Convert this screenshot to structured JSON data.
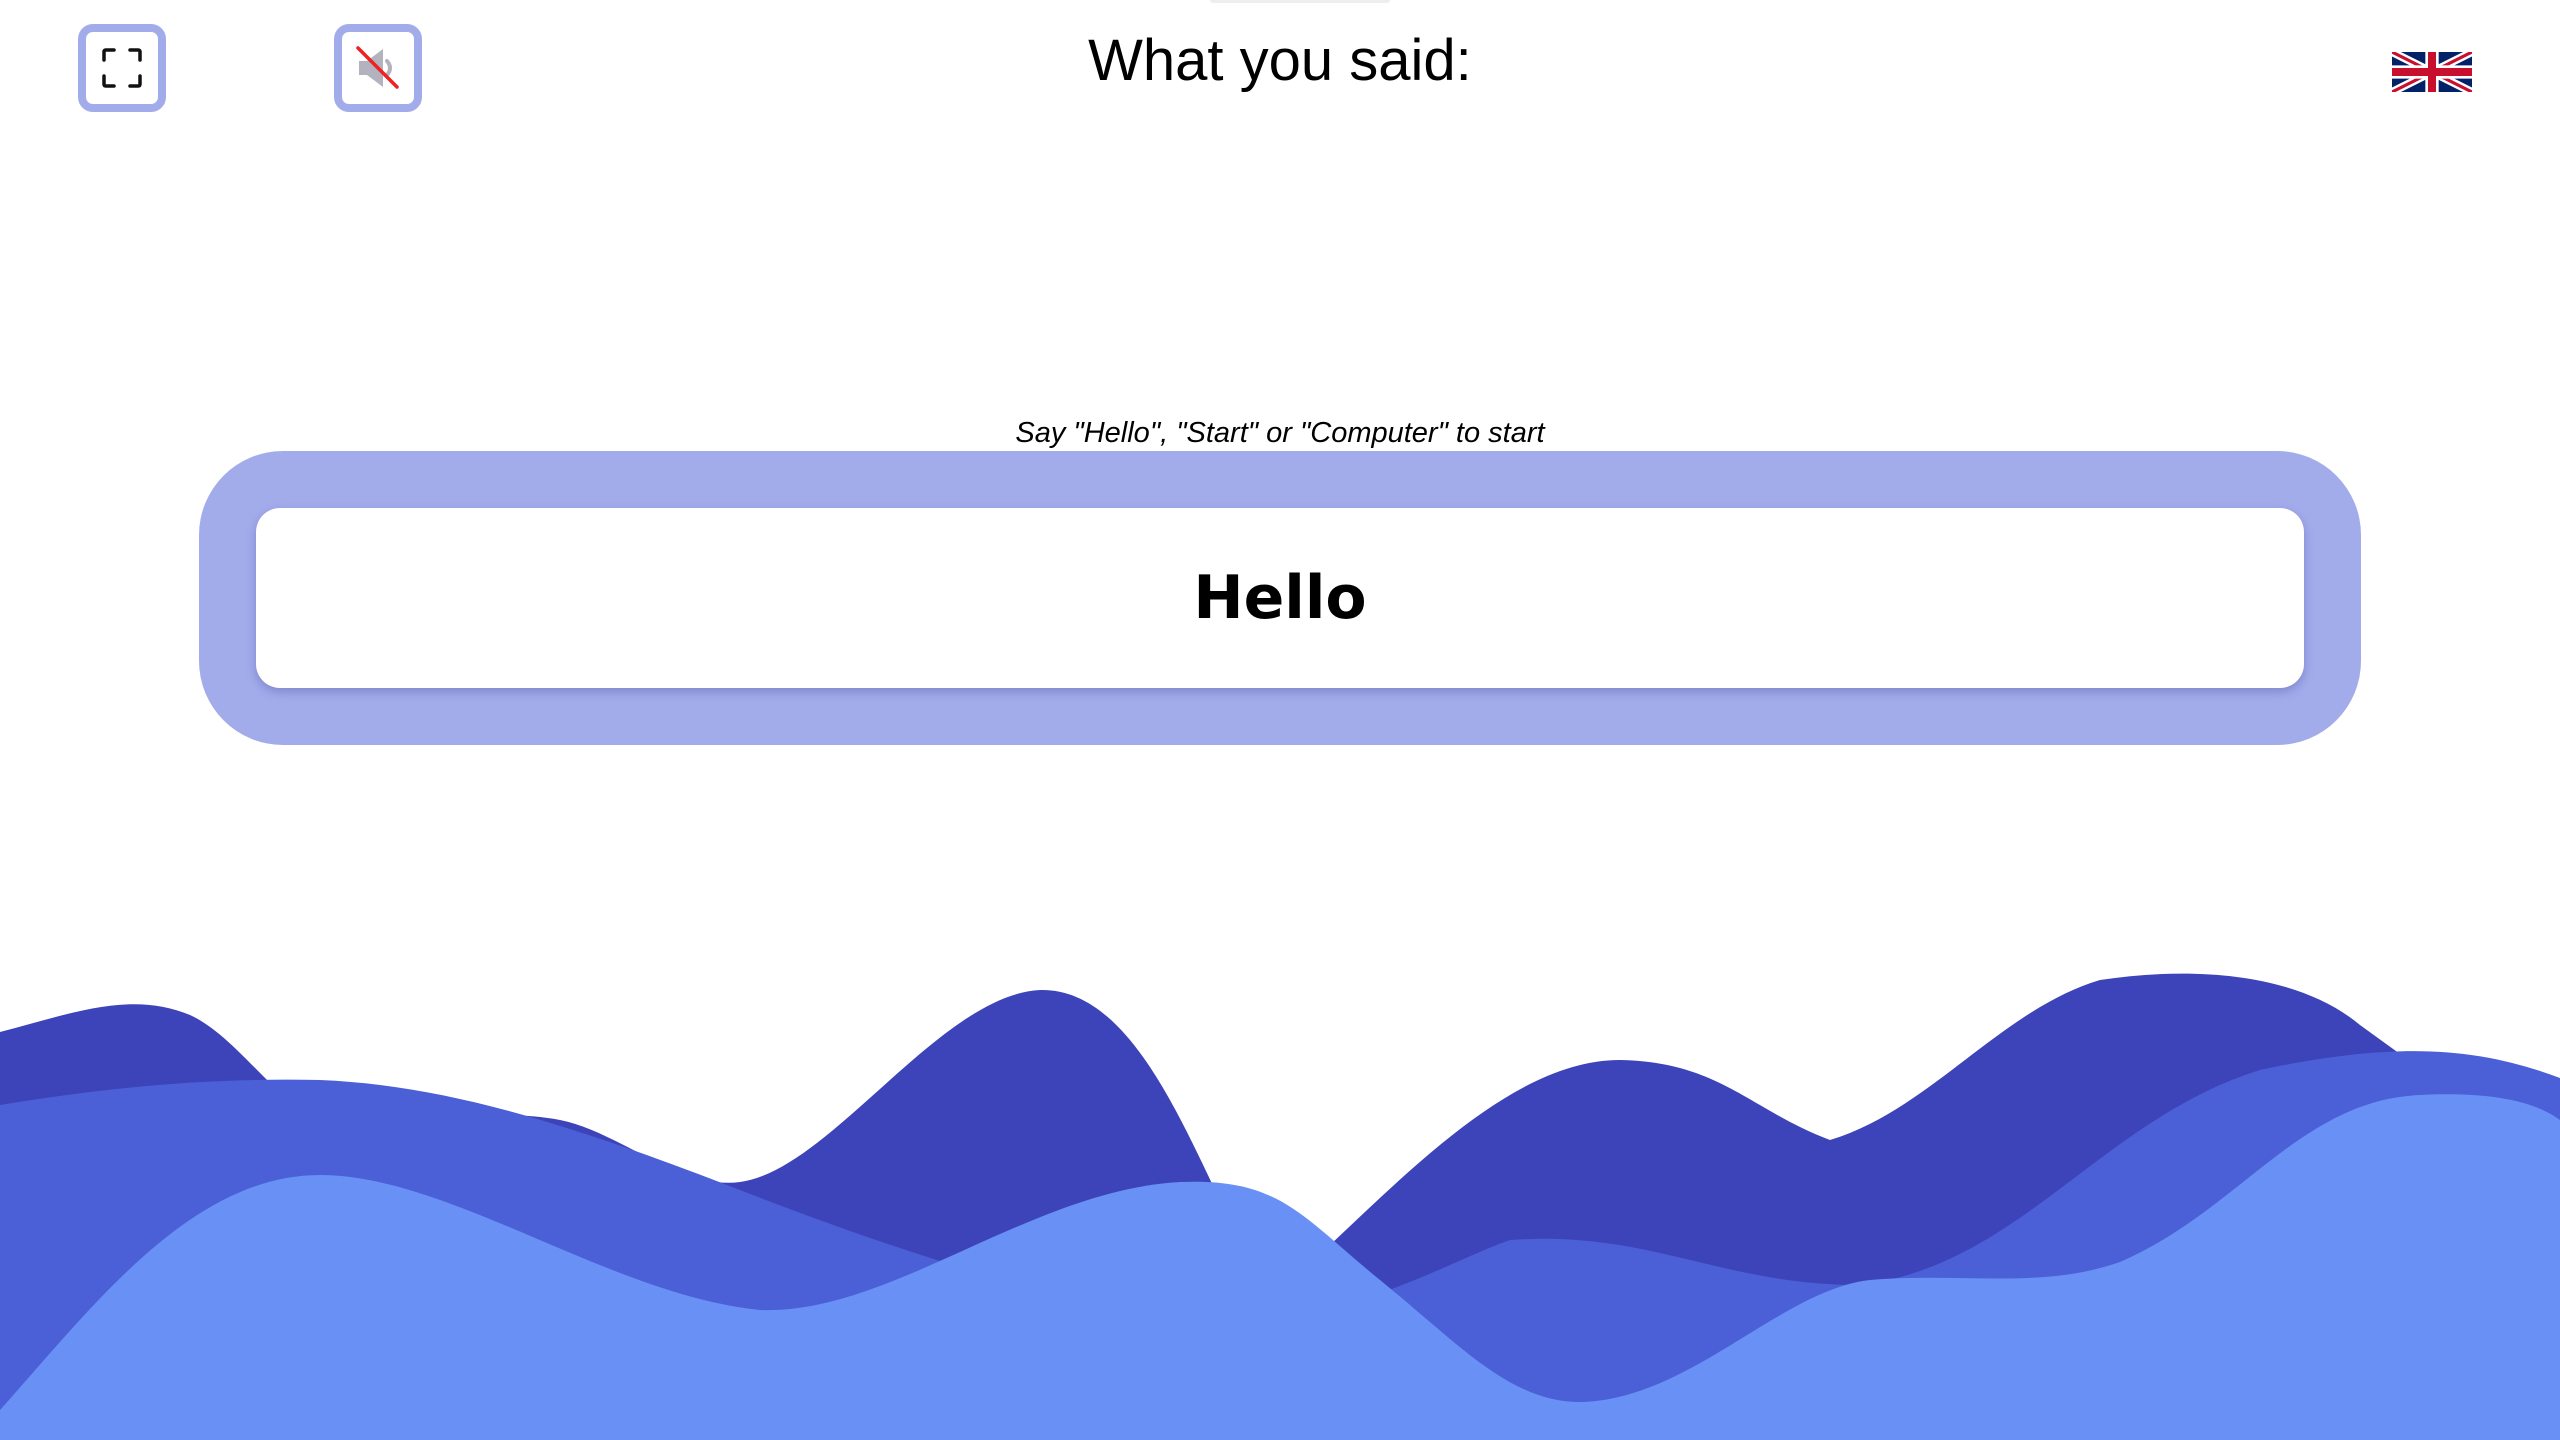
{
  "header": {
    "title": "What you said:"
  },
  "controls": {
    "fullscreen_icon": "fullscreen-icon",
    "mute_icon": "speaker-muted-icon",
    "language_flag": "uk-flag-icon"
  },
  "prompt": {
    "hint": "Say \"Hello\", \"Start\" or \"Computer\" to start"
  },
  "transcript": {
    "text": "Hello"
  },
  "colors": {
    "accent_frame": "#a3aceb",
    "wave_back": "#3d43b8",
    "wave_middle": "#4b5fd6",
    "wave_front": "#6890f5"
  }
}
